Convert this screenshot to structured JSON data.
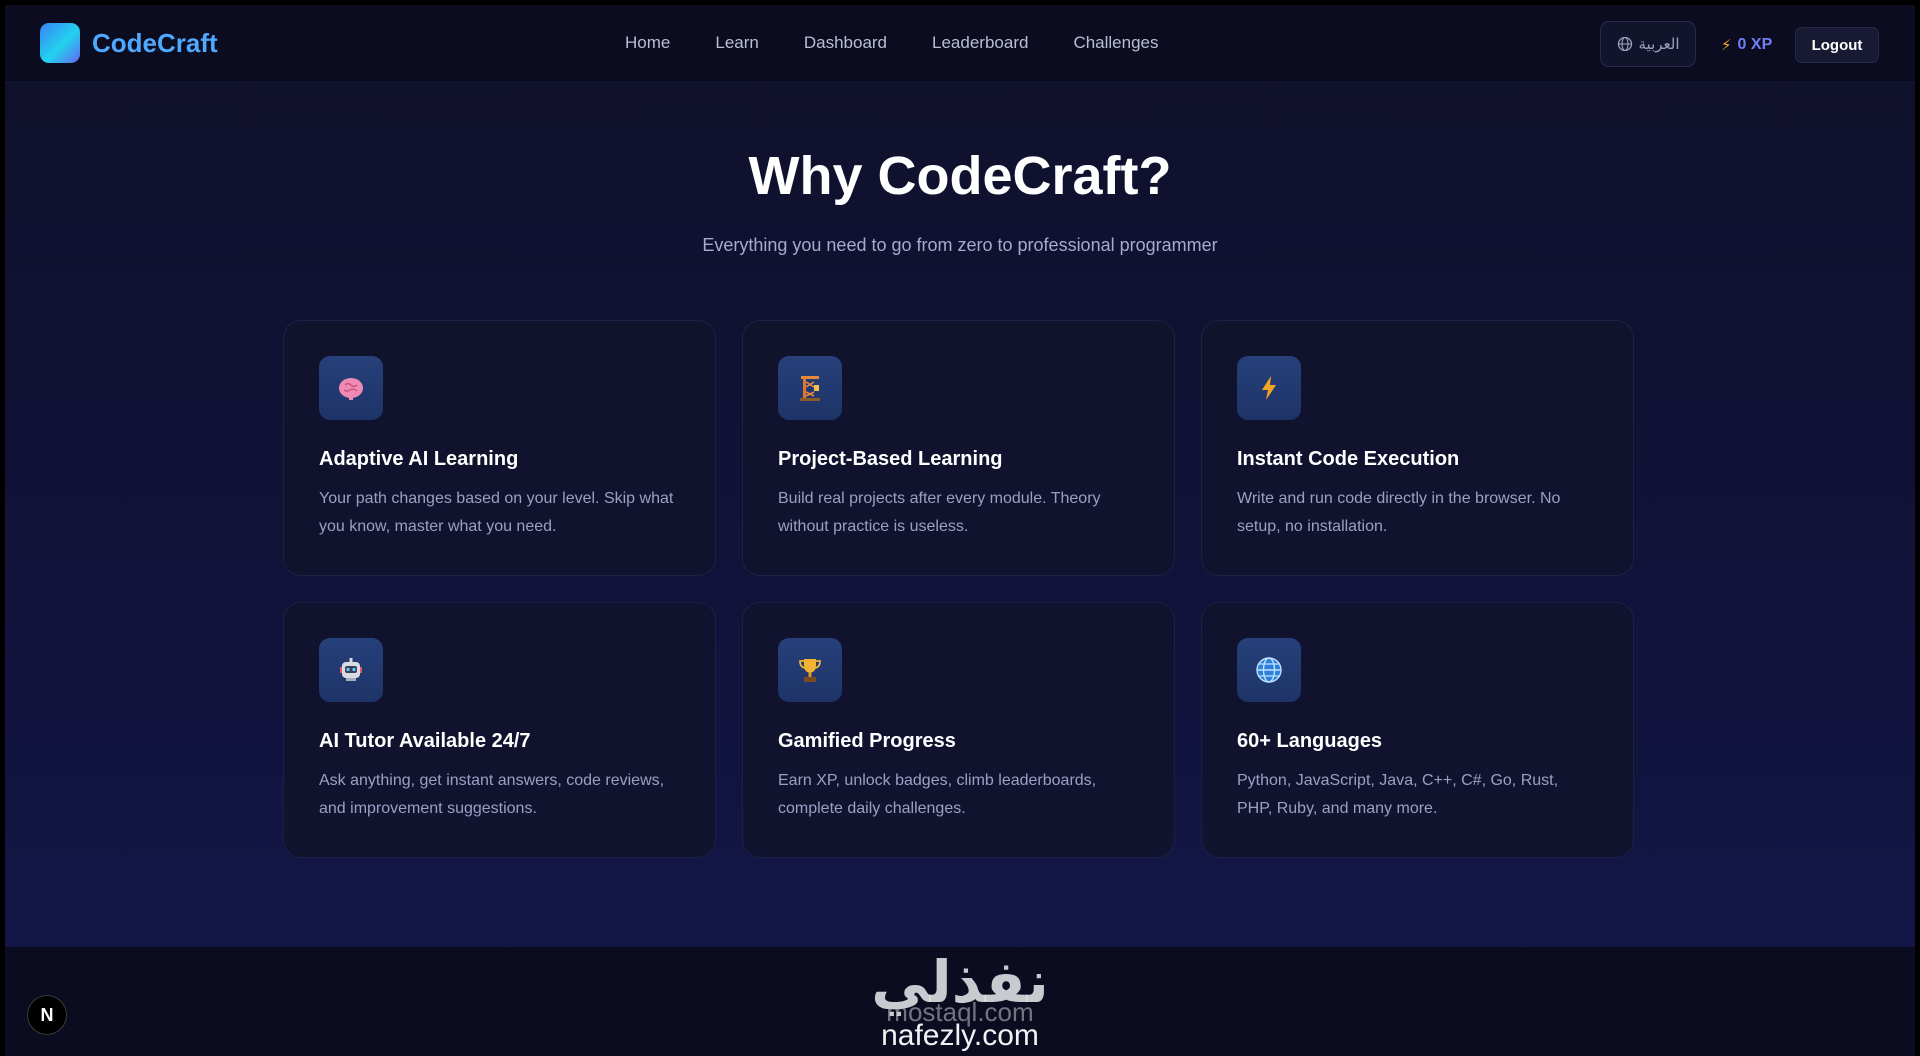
{
  "header": {
    "brand": "CodeCraft",
    "nav": [
      "Home",
      "Learn",
      "Dashboard",
      "Leaderboard",
      "Challenges"
    ],
    "language_label": "العربية",
    "xp_label": "0 XP",
    "logout_label": "Logout"
  },
  "section": {
    "title": "Why CodeCraft?",
    "subtitle": "Everything you need to go from zero to professional programmer"
  },
  "features": [
    {
      "icon": "brain-icon",
      "title": "Adaptive AI Learning",
      "description": "Your path changes based on your level. Skip what you know, master what you need."
    },
    {
      "icon": "construction-icon",
      "title": "Project-Based Learning",
      "description": "Build real projects after every module. Theory without practice is useless."
    },
    {
      "icon": "lightning-icon",
      "title": "Instant Code Execution",
      "description": "Write and run code directly in the browser. No setup, no installation."
    },
    {
      "icon": "robot-icon",
      "title": "AI Tutor Available 24/7",
      "description": "Ask anything, get instant answers, code reviews, and improvement suggestions."
    },
    {
      "icon": "trophy-icon",
      "title": "Gamified Progress",
      "description": "Earn XP, unlock badges, climb leaderboards, complete daily challenges."
    },
    {
      "icon": "globe-icon",
      "title": "60+ Languages",
      "description": "Python, JavaScript, Java, C++, C#, Go, Rust, PHP, Ruby, and many more."
    }
  ],
  "footer": {
    "badge": "N",
    "watermark_arabic": "نفذلي",
    "watermark_mostaql": "mostaql.com",
    "watermark_nafezly": "nafezly.com"
  },
  "colors": {
    "brand": "#4fa8ff",
    "xp": "#6f7ff5",
    "background": "#0f1029"
  }
}
